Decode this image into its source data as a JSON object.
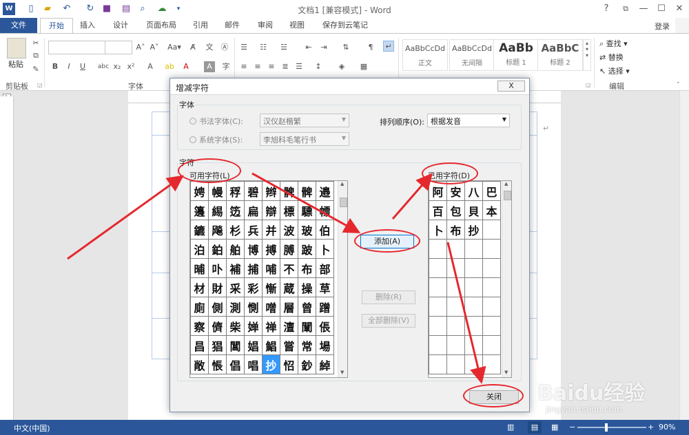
{
  "titlebar": {
    "title": "文档1 [兼容模式] - Word",
    "help": "?",
    "restore_ribbon": "⧉",
    "minimize": "—",
    "maximize": "☐",
    "close": "✕",
    "login": "登录"
  },
  "tabs": [
    "文件",
    "开始",
    "插入",
    "设计",
    "页面布局",
    "引用",
    "邮件",
    "审阅",
    "视图",
    "保存到云笔记"
  ],
  "ribbon": {
    "paste_label": "粘贴",
    "clipboard_label": "剪贴板",
    "font_label": "字体",
    "editing_label": "编辑",
    "find": "查找",
    "replace": "替换",
    "select": "选择",
    "styles": [
      {
        "sample": "AaBbCcDd",
        "name": "正文"
      },
      {
        "sample": "AaBbCcDd",
        "name": "无间隔"
      },
      {
        "sample": "AaBb",
        "name": "标题 1"
      },
      {
        "sample": "AaBbC",
        "name": "标题 2"
      }
    ]
  },
  "dialog": {
    "title": "增减字符",
    "title_close": "X",
    "font_group": "字体",
    "calligraphy_font_label": "书法字体(C):",
    "calligraphy_font_value": "汉仪赵楷繁",
    "system_font_label": "系统字体(S):",
    "system_font_value": "李旭科毛笔行书",
    "sort_label": "排列顺序(O):",
    "sort_value": "根据发音",
    "chars_group": "字符",
    "available_label": "可用字符(L)",
    "used_label": "已用字符(D)",
    "add_button": "添加(A)",
    "delete_button": "删除(R)",
    "delete_all_button": "全部删除(V)",
    "close_button": "关闭",
    "available_chars": [
      [
        "娉",
        "幔",
        "稃",
        "碧",
        "辫",
        "髀",
        "髀",
        "邉"
      ],
      [
        "籩",
        "緆",
        "笾",
        "扁",
        "辯",
        "標",
        "驃",
        "幖"
      ],
      [
        "鑣",
        "飚",
        "杉",
        "兵",
        "并",
        "波",
        "玻",
        "伯"
      ],
      [
        "泊",
        "鉑",
        "舶",
        "博",
        "搏",
        "膊",
        "跛",
        "卜"
      ],
      [
        "晡",
        "卟",
        "補",
        "捕",
        "哺",
        "不",
        "布",
        "部"
      ],
      [
        "材",
        "財",
        "采",
        "彩",
        "慚",
        "蔵",
        "操",
        "草"
      ],
      [
        "廁",
        "側",
        "測",
        "惻",
        "噌",
        "層",
        "曾",
        "蹭"
      ],
      [
        "察",
        "儕",
        "柴",
        "婵",
        "禅",
        "澶",
        "闡",
        "倀"
      ],
      [
        "昌",
        "猖",
        "閶",
        "娼",
        "鯧",
        "嘗",
        "常",
        "場"
      ],
      [
        "敞",
        "悵",
        "倡",
        "唱",
        "抄",
        "怊",
        "鈔",
        "綽"
      ]
    ],
    "used_chars": [
      [
        "阿",
        "安",
        "八",
        "巴"
      ],
      [
        "百",
        "包",
        "貝",
        "本"
      ],
      [
        "卜",
        "布",
        "抄",
        ""
      ],
      [
        "",
        "",
        "",
        ""
      ],
      [
        "",
        "",
        "",
        ""
      ],
      [
        "",
        "",
        "",
        ""
      ],
      [
        "",
        "",
        "",
        ""
      ],
      [
        "",
        "",
        "",
        ""
      ],
      [
        "",
        "",
        "",
        ""
      ],
      [
        "",
        "",
        "",
        ""
      ]
    ],
    "selected_char": "抄"
  },
  "status": {
    "language": "中文(中国)",
    "zoom": "90%"
  },
  "watermark": {
    "text": "Baidu经验",
    "url": "jingyan.baidu.com"
  },
  "colors": {
    "word_blue": "#2b579a",
    "annotation_red": "#e5282e",
    "selected_cell": "#3399ff"
  }
}
